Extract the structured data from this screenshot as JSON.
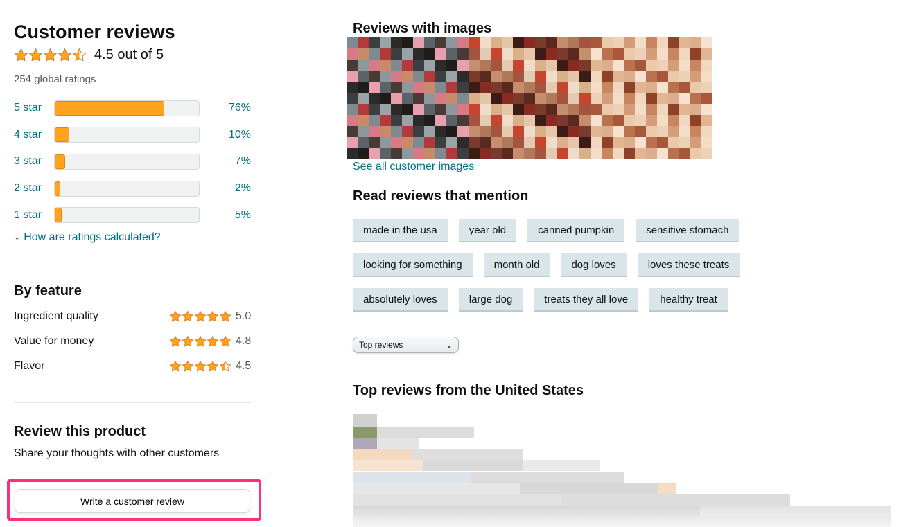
{
  "summary": {
    "title": "Customer reviews",
    "rating_value": 4.5,
    "rating_text": "4.5 out of 5",
    "global_ratings": "254 global ratings"
  },
  "histogram": [
    {
      "label": "5 star",
      "percent": 76,
      "percent_text": "76%"
    },
    {
      "label": "4 star",
      "percent": 10,
      "percent_text": "10%"
    },
    {
      "label": "3 star",
      "percent": 7,
      "percent_text": "7%"
    },
    {
      "label": "2 star",
      "percent": 2,
      "percent_text": "2%"
    },
    {
      "label": "1 star",
      "percent": 5,
      "percent_text": "5%"
    }
  ],
  "how_link": "How are ratings calculated?",
  "by_feature": {
    "title": "By feature",
    "items": [
      {
        "name": "Ingredient quality",
        "rating": 5.0,
        "score_text": "5.0"
      },
      {
        "name": "Value for money",
        "rating": 4.8,
        "score_text": "4.8"
      },
      {
        "name": "Flavor",
        "rating": 4.5,
        "score_text": "4.5"
      }
    ]
  },
  "review_product": {
    "title": "Review this product",
    "subtitle": "Share your thoughts with other customers",
    "button_label": "Write a customer review"
  },
  "images_section": {
    "title": "Reviews with images",
    "see_all": "See all customer images"
  },
  "mentions": {
    "title": "Read reviews that mention",
    "chips": [
      "made in the usa",
      "year old",
      "canned pumpkin",
      "sensitive stomach",
      "looking for something",
      "month old",
      "dog loves",
      "loves these treats",
      "absolutely loves",
      "large dog",
      "treats they all love",
      "healthy treat"
    ]
  },
  "sort": {
    "selected": "Top reviews"
  },
  "top_reviews_title": "Top reviews from the United States",
  "colors": {
    "star": "#ffa41c",
    "link": "#007185",
    "chip_bg": "#d9e5e8",
    "highlight": "#ff2f7a"
  }
}
